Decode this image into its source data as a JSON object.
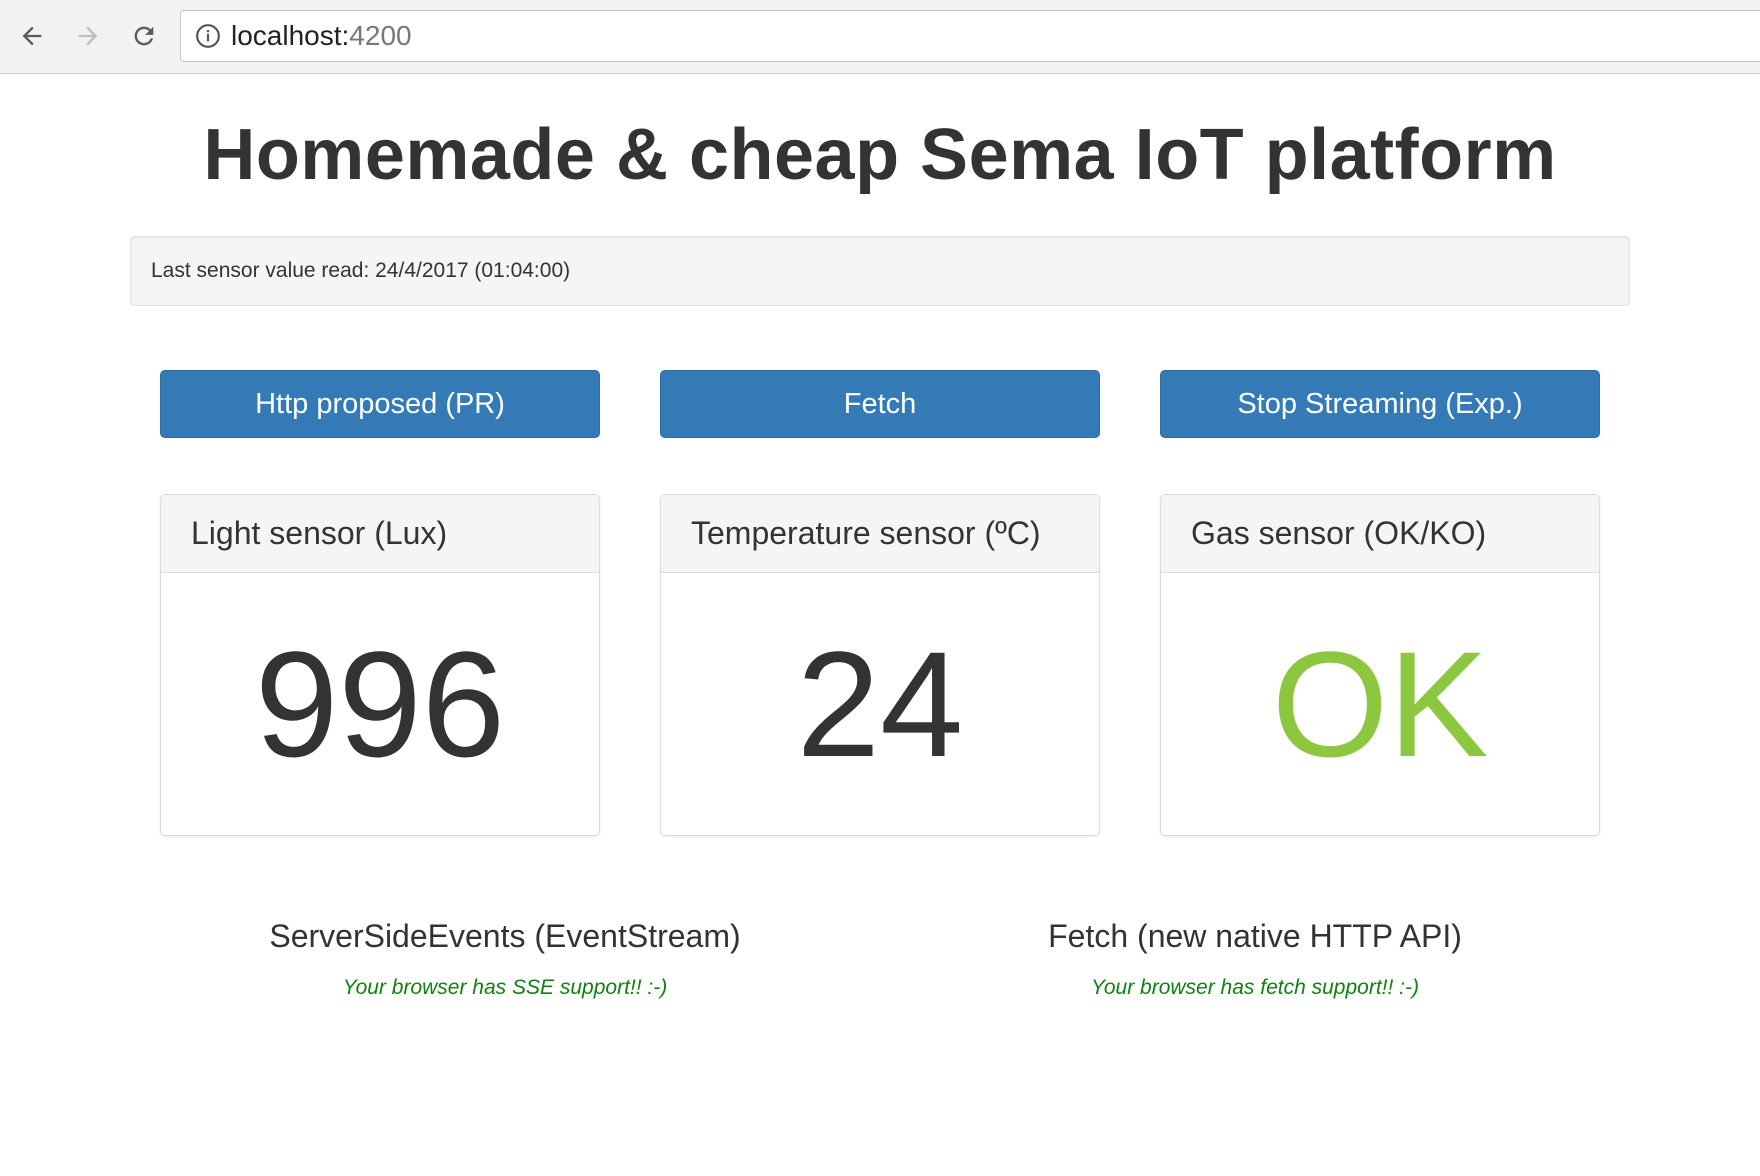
{
  "browser": {
    "url_host": "localhost:",
    "url_port": "4200"
  },
  "page": {
    "title": "Homemade & cheap Sema IoT platform",
    "status": "Last sensor value read: 24/4/2017 (01:04:00)"
  },
  "buttons": {
    "http_label": "Http proposed (PR)",
    "fetch_label": "Fetch",
    "stop_label": "Stop Streaming (Exp.)",
    "color": "#337ab7"
  },
  "sensors": [
    {
      "title": "Light sensor (Lux)",
      "value": "996"
    },
    {
      "title": "Temperature sensor (ºC)",
      "value": "24"
    },
    {
      "title": "Gas sensor (OK/KO)",
      "value": "OK",
      "value_color": "#8dc63f"
    }
  ],
  "support": {
    "sse": {
      "title": "ServerSideEvents (EventStream)",
      "message": "Your browser has SSE support!! :-)"
    },
    "fetch": {
      "title": "Fetch (new native HTTP API)",
      "message": "Your browser has fetch support!! :-)"
    },
    "message_color": "#118011"
  },
  "icons": [
    "back-arrow-icon",
    "forward-arrow-icon",
    "reload-icon",
    "info-icon"
  ]
}
